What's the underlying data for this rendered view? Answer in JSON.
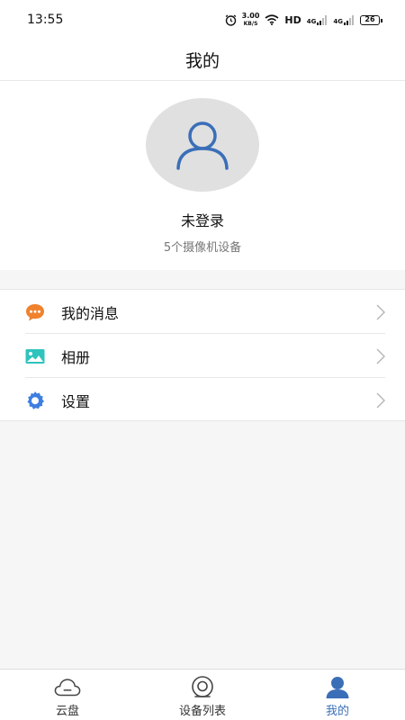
{
  "status_bar": {
    "time": "13:55",
    "net_speed_value": "3.00",
    "net_speed_unit": "KB/S",
    "hd_label": "HD",
    "signal_1_label": "4G",
    "signal_2_label": "4G",
    "battery_level": "26"
  },
  "header": {
    "title": "我的"
  },
  "profile": {
    "user_name": "未登录",
    "device_count": "5个摄像机设备"
  },
  "menu": {
    "items": [
      {
        "label": "我的消息",
        "icon": "message-icon",
        "color": "#f0822d"
      },
      {
        "label": "相册",
        "icon": "photo-album-icon",
        "color": "#2fc3bd"
      },
      {
        "label": "设置",
        "icon": "settings-gear-icon",
        "color": "#3e7ee0"
      }
    ]
  },
  "tabbar": {
    "tabs": [
      {
        "label": "云盘",
        "icon": "cloud-icon"
      },
      {
        "label": "设备列表",
        "icon": "camera-icon"
      },
      {
        "label": "我的",
        "icon": "user-icon",
        "active": true
      }
    ]
  },
  "colors": {
    "accent": "#3a6fb8",
    "avatar_bg": "#e0e0e0",
    "page_bg": "#f6f6f6"
  }
}
